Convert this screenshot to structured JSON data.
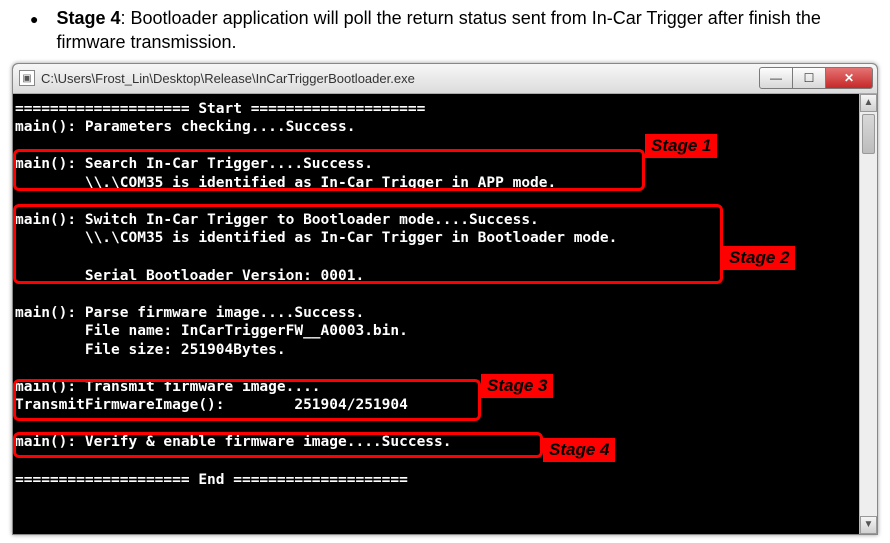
{
  "bullet": {
    "label": "Stage 4",
    "text": ": Bootloader application will poll the return status sent from In-Car Trigger after finish the firmware transmission."
  },
  "window": {
    "title": "C:\\Users\\Frost_Lin\\Desktop\\Release\\InCarTriggerBootloader.exe",
    "icon_glyph": "▣",
    "btn_min": "—",
    "btn_max": "☐",
    "btn_close": "✕"
  },
  "scroll": {
    "up": "▲",
    "down": "▼"
  },
  "console": {
    "l01": "==================== Start ====================",
    "l02": "main(): Parameters checking....Success.",
    "l03": "",
    "l04": "main(): Search In-Car Trigger....Success.",
    "l05": "        \\\\.\\COM35 is identified as In-Car Trigger in APP mode.",
    "l06": "",
    "l07": "main(): Switch In-Car Trigger to Bootloader mode....Success.",
    "l08": "        \\\\.\\COM35 is identified as In-Car Trigger in Bootloader mode.",
    "l09": "",
    "l10": "        Serial Bootloader Version: 0001.",
    "l11": "",
    "l12": "main(): Parse firmware image....Success.",
    "l13": "        File name: InCarTriggerFW__A0003.bin.",
    "l14": "        File size: 251904Bytes.",
    "l15": "",
    "l16": "main(): Transmit firmware image....",
    "l17": "TransmitFirmwareImage():        251904/251904",
    "l18": "",
    "l19": "main(): Verify & enable firmware image....Success.",
    "l20": "",
    "l21": "==================== End ===================="
  },
  "tags": {
    "s1": "Stage 1",
    "s2": "Stage 2",
    "s3": "Stage 3",
    "s4": "Stage 4"
  }
}
